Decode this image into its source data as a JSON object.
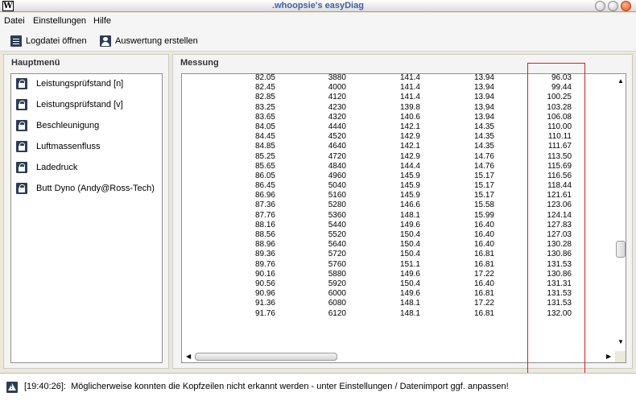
{
  "window": {
    "title": ".whoopsie's easyDiag",
    "app_icon_glyph": "W"
  },
  "menu": {
    "items": [
      "Datei",
      "Einstellungen",
      "Hilfe"
    ]
  },
  "toolbar": {
    "open_log_label": "Logdatei öffnen",
    "create_eval_label": "Auswertung erstellen"
  },
  "left_panel": {
    "title": "Hauptmenü",
    "items": [
      "Leistungsprüfstand [n]",
      "Leistungsprüfstand [v]",
      "Beschleunigung",
      "Luftmassenfluss",
      "Ladedruck",
      "Butt Dyno (Andy@Ross-Tech)"
    ]
  },
  "right_panel": {
    "title": "Messung",
    "rows": [
      [
        "82.05",
        "3880",
        "141.4",
        "13.94",
        "96.03"
      ],
      [
        "82.45",
        "4000",
        "141.4",
        "13.94",
        "99.44"
      ],
      [
        "82.85",
        "4120",
        "141.4",
        "13.94",
        "100.25"
      ],
      [
        "83.25",
        "4230",
        "139.8",
        "13.94",
        "103.28"
      ],
      [
        "83.65",
        "4320",
        "140.6",
        "13.94",
        "106.08"
      ],
      [
        "84.05",
        "4440",
        "142.1",
        "14.35",
        "110.00"
      ],
      [
        "84.45",
        "4520",
        "142.9",
        "14.35",
        "110.11"
      ],
      [
        "84.85",
        "4640",
        "142.1",
        "14.35",
        "111.67"
      ],
      [
        "85.25",
        "4720",
        "142.9",
        "14.76",
        "113.50"
      ],
      [
        "85.65",
        "4840",
        "144.4",
        "14.76",
        "115.69"
      ],
      [
        "86.05",
        "4960",
        "145.9",
        "15.17",
        "116.56"
      ],
      [
        "86.45",
        "5040",
        "145.9",
        "15.17",
        "118.44"
      ],
      [
        "86.96",
        "5160",
        "145.9",
        "15.17",
        "121.61"
      ],
      [
        "87.36",
        "5280",
        "146.6",
        "15.58",
        "123.06"
      ],
      [
        "87.76",
        "5360",
        "148.1",
        "15.99",
        "124.14"
      ],
      [
        "88.16",
        "5440",
        "149.6",
        "16.40",
        "127.83"
      ],
      [
        "88.56",
        "5520",
        "150.4",
        "16.40",
        "127.03"
      ],
      [
        "88.96",
        "5640",
        "150.4",
        "16.40",
        "130.28"
      ],
      [
        "89.36",
        "5720",
        "150.4",
        "16.81",
        "130.86"
      ],
      [
        "89.76",
        "5760",
        "151.1",
        "16.81",
        "131.53"
      ],
      [
        "90.16",
        "5880",
        "149.6",
        "17.22",
        "130.86"
      ],
      [
        "90.56",
        "5920",
        "150.4",
        "16.40",
        "131.31"
      ],
      [
        "90.96",
        "6000",
        "149.6",
        "16.81",
        "131.53"
      ],
      [
        "91.36",
        "6080",
        "148.1",
        "17.22",
        "131.53"
      ],
      [
        "91.76",
        "6120",
        "148.1",
        "16.81",
        "132.00"
      ]
    ]
  },
  "status": {
    "timestamp": "[19:40:26]:",
    "message": "Möglicherweise konnten die Kopfzeilen nicht erkannt werden - unter Einstellungen / Datenimport ggf. anpassen!"
  },
  "colors": {
    "title_text": "#3d5fa7",
    "highlight_border": "#e21a1a",
    "icon_fill": "#2c3d55"
  }
}
